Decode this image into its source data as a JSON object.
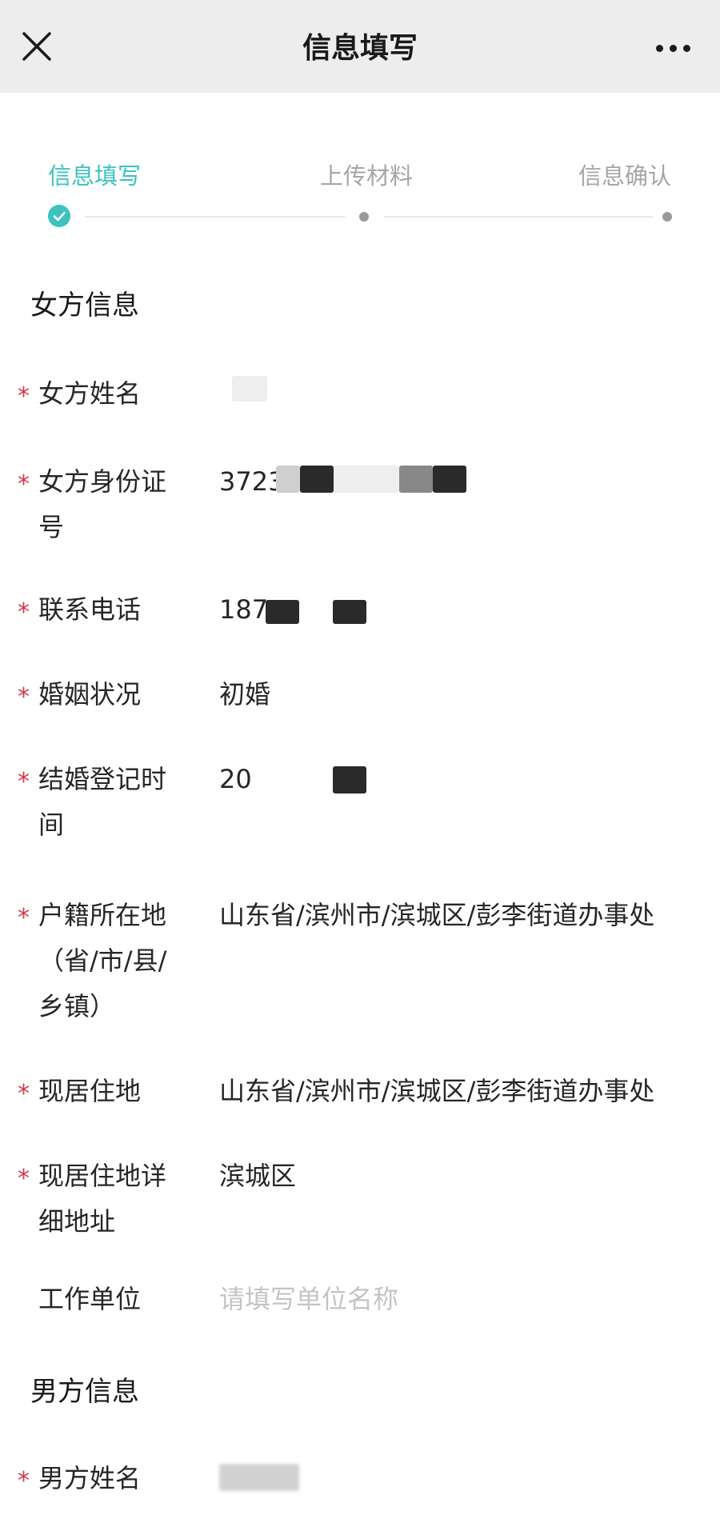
{
  "navbar": {
    "title": "信息填写",
    "close_icon": "close-icon",
    "more_icon": "more-dots-icon"
  },
  "stepper": {
    "steps": [
      {
        "label": "信息填写",
        "state": "done"
      },
      {
        "label": "上传材料",
        "state": "pending"
      },
      {
        "label": "信息确认",
        "state": "pending"
      }
    ],
    "accent_color": "#3cc2c0"
  },
  "female": {
    "section_title": "女方信息",
    "fields": [
      {
        "label": "女方姓名",
        "required": "*",
        "value": ""
      },
      {
        "label": "女方身份证号",
        "required": "*",
        "value": "3723"
      },
      {
        "label": "联系电话",
        "required": "*",
        "value": "187"
      },
      {
        "label": "婚姻状况",
        "required": "*",
        "value": "初婚"
      },
      {
        "label": "结婚登记时间",
        "required": "*",
        "value": "20"
      },
      {
        "label": "户籍所在地（省/市/县/乡镇）",
        "required": "*",
        "value": "山东省/滨州市/滨城区/彭李街道办事处"
      },
      {
        "label": "现居住地",
        "required": "*",
        "value": "山东省/滨州市/滨城区/彭李街道办事处"
      },
      {
        "label": "现居住地详细地址",
        "required": "*",
        "value": "滨城区"
      },
      {
        "label": "工作单位",
        "required": "",
        "value": "",
        "placeholder": "请填写单位名称"
      }
    ]
  },
  "male": {
    "section_title": "男方信息",
    "fields": [
      {
        "label": "男方姓名",
        "required": "*",
        "value": ""
      }
    ]
  },
  "colors": {
    "required_star": "#d0394a",
    "navbar_bg": "#ededed",
    "placeholder": "#c4c4c4"
  }
}
